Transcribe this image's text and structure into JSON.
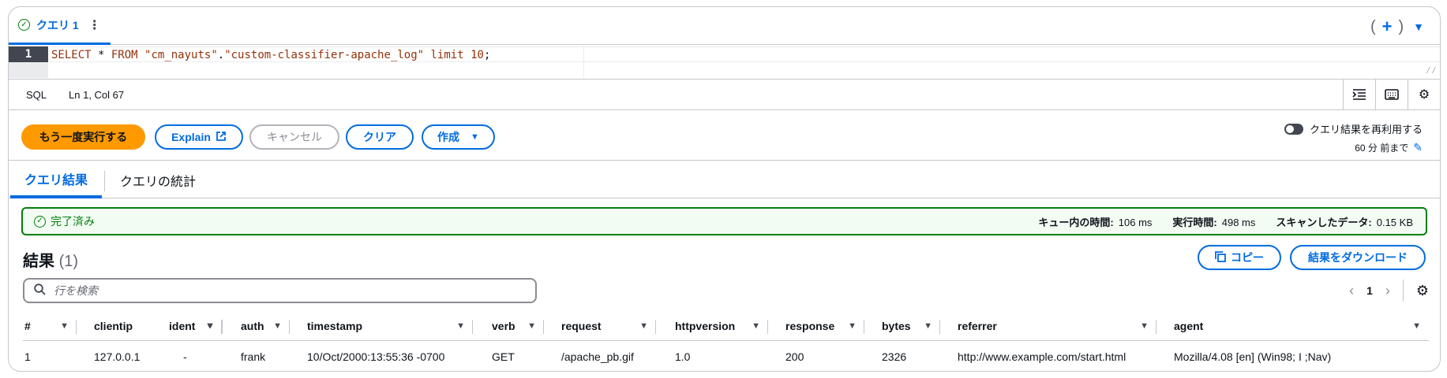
{
  "query_tab": {
    "label": "クエリ 1",
    "status_icon": "check-circle-icon",
    "menu_icon": "more-vertical-icon"
  },
  "tab_tools": {
    "open_paren": "(",
    "add": "+",
    "close_paren": ")",
    "dropdown_icon": "caret-down-icon"
  },
  "editor": {
    "line_number": "1",
    "tokens": [
      "SELECT",
      " * ",
      "FROM",
      " ",
      "\"cm_nayuts\"",
      ".",
      "\"custom-classifier-apache_log\"",
      " ",
      "limit",
      " ",
      "10",
      ";"
    ]
  },
  "status_bar": {
    "language": "SQL",
    "position": "Ln 1, Col 67"
  },
  "actions": {
    "run_again": "もう一度実行する",
    "explain": "Explain",
    "cancel": "キャンセル",
    "clear": "クリア",
    "create": "作成"
  },
  "reuse": {
    "label": "クエリ結果を再利用する",
    "age": "60 分 前まで"
  },
  "result_tabs": {
    "results": "クエリ結果",
    "stats": "クエリの統計"
  },
  "banner": {
    "status": "完了済み",
    "queue_label": "キュー内の時間:",
    "queue_value": "106 ms",
    "exec_label": "実行時間:",
    "exec_value": "498 ms",
    "scan_label": "スキャンしたデータ:",
    "scan_value": "0.15 KB"
  },
  "results": {
    "title": "結果",
    "count": "(1)",
    "copy": "コピー",
    "download": "結果をダウンロード",
    "search_placeholder": "行を検索",
    "page": "1"
  },
  "table": {
    "columns": [
      "#",
      "clientip",
      "ident",
      "auth",
      "timestamp",
      "verb",
      "request",
      "httpversion",
      "response",
      "bytes",
      "referrer",
      "agent"
    ],
    "rows": [
      [
        "1",
        "127.0.0.1",
        "-",
        "frank",
        "10/Oct/2000:13:55:36 -0700",
        "GET",
        "/apache_pb.gif",
        "1.0",
        "200",
        "2326",
        "http://www.example.com/start.html",
        "Mozilla/4.08 [en] (Win98; I ;Nav)"
      ]
    ]
  },
  "colors": {
    "accent": "#006ce0",
    "primary_button": "#ff9900",
    "success": "#037f0c",
    "success_bg": "#f2fcf3"
  }
}
